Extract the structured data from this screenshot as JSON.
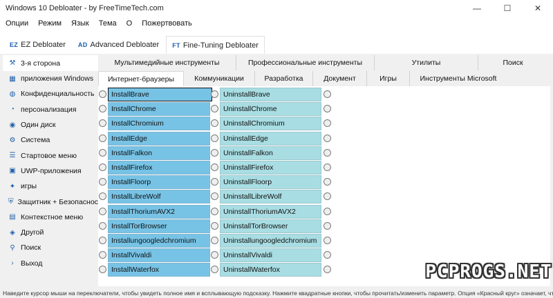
{
  "window": {
    "title": "Windows 10 Debloater - by FreeTimeTech.com",
    "controls": [
      "—",
      "☐",
      "✕"
    ]
  },
  "menu": [
    "Опции",
    "Режим",
    "Язык",
    "Тема",
    "О",
    "Пожертвовать"
  ],
  "modes": [
    {
      "badge": "EZ",
      "label": "EZ Debloater"
    },
    {
      "badge": "AD",
      "label": "Advanced Debloater"
    },
    {
      "badge": "FT",
      "label": "Fine-Tuning Debloater"
    }
  ],
  "sidebar": [
    {
      "icon": "tools-icon",
      "glyph": "⚒",
      "label": "3-я сторона"
    },
    {
      "icon": "apps-icon",
      "glyph": "▦",
      "label": "приложения Windows"
    },
    {
      "icon": "privacy-icon",
      "glyph": "◍",
      "label": "Конфиденциальность"
    },
    {
      "icon": "personalization-icon",
      "glyph": "◔",
      "label": "персонализация"
    },
    {
      "icon": "disk-icon",
      "glyph": "◉",
      "label": "Один диск"
    },
    {
      "icon": "system-icon",
      "glyph": "⚙",
      "label": "Система"
    },
    {
      "icon": "start-menu-icon",
      "glyph": "☰",
      "label": "Стартовое меню"
    },
    {
      "icon": "uwp-icon",
      "glyph": "▣",
      "label": "UWP-приложения"
    },
    {
      "icon": "games-icon",
      "glyph": "✦",
      "label": "игры"
    },
    {
      "icon": "security-icon",
      "glyph": "⛨",
      "label": "Защитник + Безопасность"
    },
    {
      "icon": "context-menu-icon",
      "glyph": "▤",
      "label": "Контекстное меню"
    },
    {
      "icon": "other-icon",
      "glyph": "◈",
      "label": "Другой"
    },
    {
      "icon": "search-icon",
      "glyph": "⚲",
      "label": "Поиск"
    },
    {
      "icon": "exit-icon",
      "glyph": "›",
      "label": "Выход"
    }
  ],
  "tabs_row1": [
    "Мультимедийные инструменты",
    "Профессиональные инструменты",
    "Утилиты",
    "Поиск"
  ],
  "tabs_row2": [
    "Интернет-браузеры",
    "Коммуникации",
    "Разработка",
    "Документ",
    "Игры",
    "Инструменты Microsoft"
  ],
  "rows": [
    {
      "install": "InstallBrave",
      "uninstall": "UninstallBrave"
    },
    {
      "install": "InstallChrome",
      "uninstall": "UninstallChrome"
    },
    {
      "install": "InstallChromium",
      "uninstall": "UninstallChromium"
    },
    {
      "install": "InstallEdge",
      "uninstall": "UninstallEdge"
    },
    {
      "install": "InstallFalkon",
      "uninstall": "UninstallFalkon"
    },
    {
      "install": "InstallFirefox",
      "uninstall": "UninstallFirefox"
    },
    {
      "install": "InstallFloorp",
      "uninstall": "UninstallFloorp"
    },
    {
      "install": "InstallLibreWolf",
      "uninstall": "UninstallLibreWolf"
    },
    {
      "install": "InstallThoriumAVX2",
      "uninstall": "UninstallThoriumAVX2"
    },
    {
      "install": "InstallTorBrowser",
      "uninstall": "UninstallTorBrowser"
    },
    {
      "install": "Installungoogledchromium",
      "uninstall": "Uninstallungoogledchromium"
    },
    {
      "install": "InstallVivaldi",
      "uninstall": "UninstallVivaldi"
    },
    {
      "install": "InstallWaterfox",
      "uninstall": "UninstallWaterfox"
    }
  ],
  "status": "Наведите курсор мыши на переключатели, чтобы увидеть полное имя и всплывающую подсказку. Нажмите квадратные кнопки, чтобы прочитать/изменить параметр. Опция «Красный круг» означает, что ничего не выбрано",
  "watermark": "PCPROGS.NET",
  "colors": {
    "install": "#77c3e6",
    "uninstall": "#a8dde3",
    "accent": "#1a5fb4"
  }
}
